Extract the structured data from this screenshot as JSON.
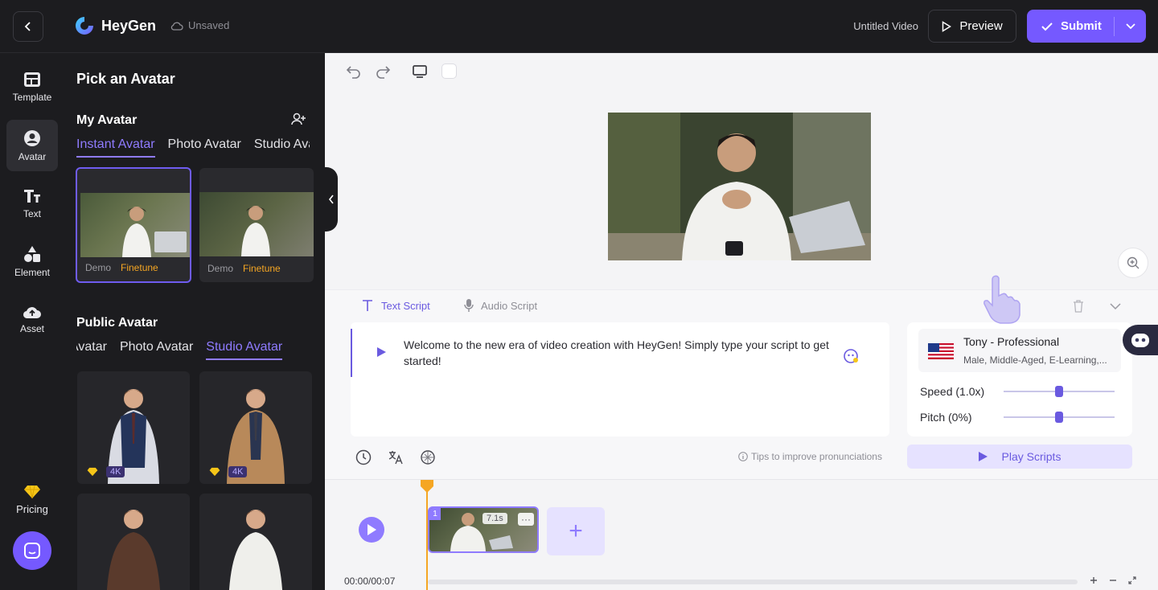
{
  "header": {
    "logo_text": "HeyGen",
    "save_status": "Unsaved",
    "video_title": "Untitled Video",
    "preview_label": "Preview",
    "submit_label": "Submit"
  },
  "rail": {
    "items": [
      {
        "label": "Template",
        "icon": "template-icon"
      },
      {
        "label": "Avatar",
        "icon": "avatar-icon"
      },
      {
        "label": "Text",
        "icon": "text-icon"
      },
      {
        "label": "Element",
        "icon": "element-icon"
      },
      {
        "label": "Asset",
        "icon": "upload-icon"
      }
    ],
    "pricing_label": "Pricing"
  },
  "panel": {
    "title": "Pick an Avatar",
    "my_avatar": {
      "title": "My Avatar",
      "tabs": [
        "Instant Avatar",
        "Photo Avatar",
        "Studio Avatar"
      ],
      "active_tab": "Instant Avatar",
      "cards": [
        {
          "tag1": "Demo",
          "tag2": "Finetune"
        },
        {
          "tag1": "Demo",
          "tag2": "Finetune"
        }
      ]
    },
    "public_avatar": {
      "title": "Public Avatar",
      "tabs": [
        "Avatar",
        "Photo Avatar",
        "Studio Avatar"
      ],
      "active_tab": "Studio Avatar",
      "cards": [
        {
          "badge": "4K"
        },
        {
          "badge": "4K"
        },
        {
          "badge": ""
        },
        {
          "badge": ""
        }
      ]
    }
  },
  "script": {
    "tabs": [
      "Text Script",
      "Audio Script"
    ],
    "active_tab": "Text Script",
    "text": "Welcome to the new era of video creation with HeyGen! Simply type your script to get started!",
    "tips_label": "Tips to improve pronunciations"
  },
  "voice": {
    "name": "Tony - Professional",
    "description": "Male, Middle-Aged, E-Learning,...",
    "speed_label": "Speed (1.0x)",
    "pitch_label": "Pitch (0%)",
    "speed_level": 0.5,
    "pitch_level": 0.5,
    "play_label": "Play Scripts"
  },
  "timeline": {
    "time_readout": "00:00/00:07",
    "clip": {
      "number": "1",
      "duration": "7.1s",
      "more": "···"
    },
    "add_label": "+"
  },
  "colors": {
    "accent": "#7559ff",
    "finetune": "#f5a623",
    "dark_bg": "#1c1c1f"
  }
}
